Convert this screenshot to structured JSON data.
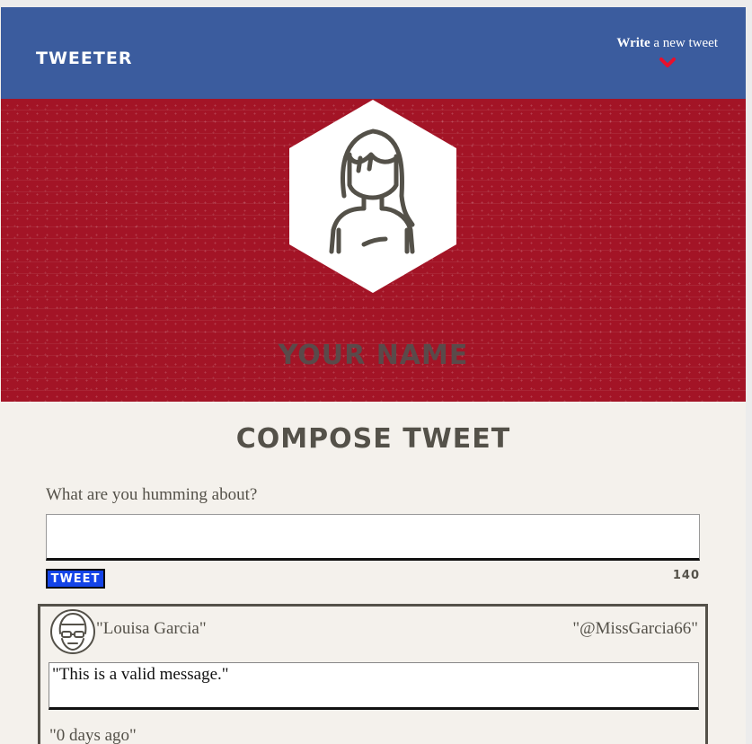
{
  "nav": {
    "brand": "TWEETER",
    "compose_bold": "Write",
    "compose_rest": " a new tweet"
  },
  "hero": {
    "name": "YOUR NAME"
  },
  "compose": {
    "title": "COMPOSE TWEET",
    "label": "What are you humming about?",
    "input_value": "",
    "button_label": "TWEET",
    "counter": "140"
  },
  "tweets": [
    {
      "name": "\"Louisa Garcia\"",
      "handle": "\"@MissGarcia66\"",
      "body": "\"This is a valid message.\"",
      "time": "\"0 days ago\""
    }
  ],
  "colors": {
    "nav": "#3b5c9e",
    "hero": "#a31426",
    "accent": "#e8102c",
    "button": "#1444e8",
    "text": "#545149",
    "background": "#f4f1ec"
  }
}
